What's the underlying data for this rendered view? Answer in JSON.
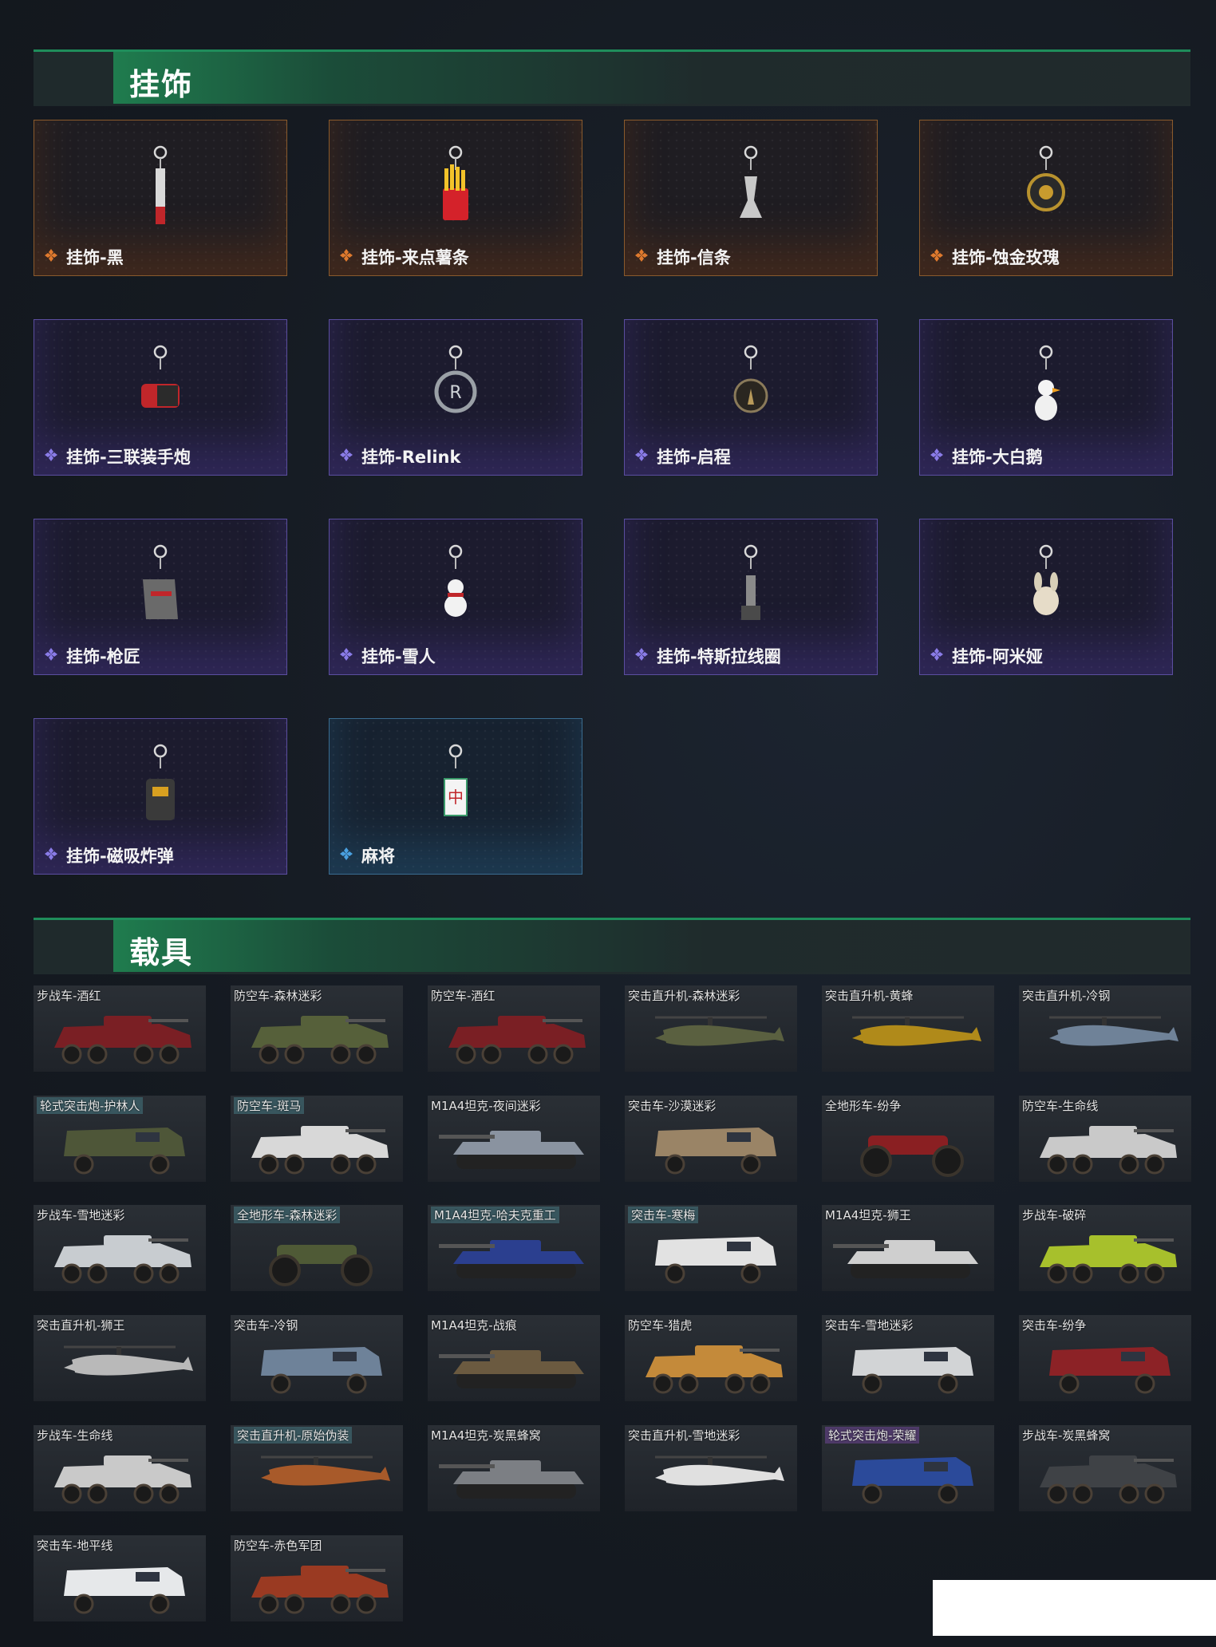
{
  "sections": {
    "pendants": {
      "title": "挂饰"
    },
    "vehicles": {
      "title": "载具"
    }
  },
  "pendants": [
    {
      "label": "挂饰-黑",
      "rarity": "gold",
      "icon": "pendant-black-icon"
    },
    {
      "label": "挂饰-来点薯条",
      "rarity": "gold",
      "icon": "pendant-fries-icon"
    },
    {
      "label": "挂饰-信条",
      "rarity": "gold",
      "icon": "pendant-creed-icon"
    },
    {
      "label": "挂饰-蚀金玫瑰",
      "rarity": "gold",
      "icon": "pendant-rose-icon"
    },
    {
      "label": "挂饰-三联装手炮",
      "rarity": "purple",
      "icon": "pendant-handcannon-icon"
    },
    {
      "label": "挂饰-Relink",
      "rarity": "purple",
      "icon": "pendant-relink-icon"
    },
    {
      "label": "挂饰-启程",
      "rarity": "purple",
      "icon": "pendant-journey-icon"
    },
    {
      "label": "挂饰-大白鹅",
      "rarity": "purple",
      "icon": "pendant-goose-icon"
    },
    {
      "label": "挂饰-枪匠",
      "rarity": "purple",
      "icon": "pendant-gunsmith-icon"
    },
    {
      "label": "挂饰-雪人",
      "rarity": "purple",
      "icon": "pendant-snowman-icon"
    },
    {
      "label": "挂饰-特斯拉线圈",
      "rarity": "purple",
      "icon": "pendant-tesla-icon"
    },
    {
      "label": "挂饰-阿米娅",
      "rarity": "purple",
      "icon": "pendant-amiya-icon"
    },
    {
      "label": "挂饰-磁吸炸弹",
      "rarity": "purple",
      "icon": "pendant-bomb-icon"
    },
    {
      "label": "麻将",
      "rarity": "blue",
      "icon": "pendant-mahjong-icon"
    }
  ],
  "vehicles": [
    {
      "name": "步战车-酒红",
      "type": "ifv",
      "color": "#7a1f24",
      "hl": ""
    },
    {
      "name": "防空车-森林迷彩",
      "type": "ifv",
      "color": "#56603a",
      "hl": ""
    },
    {
      "name": "防空车-酒红",
      "type": "ifv",
      "color": "#7a1f24",
      "hl": ""
    },
    {
      "name": "突击直升机-森林迷彩",
      "type": "heli",
      "color": "#5a6040",
      "hl": ""
    },
    {
      "name": "突击直升机-黄蜂",
      "type": "heli",
      "color": "#b08a1a",
      "hl": ""
    },
    {
      "name": "突击直升机-冷钢",
      "type": "heli",
      "color": "#6f8298",
      "hl": ""
    },
    {
      "name": "轮式突击炮-护林人",
      "type": "armored",
      "color": "#4e5638",
      "hl": "hl"
    },
    {
      "name": "防空车-斑马",
      "type": "ifv",
      "color": "#d8d8d8",
      "hl": "hl"
    },
    {
      "name": "M1A4坦克-夜间迷彩",
      "type": "tank",
      "color": "#8a93a0",
      "hl": ""
    },
    {
      "name": "突击车-沙漠迷彩",
      "type": "truck",
      "color": "#9a8466",
      "hl": ""
    },
    {
      "name": "全地形车-纷争",
      "type": "atv",
      "color": "#8a1f22",
      "hl": ""
    },
    {
      "name": "防空车-生命线",
      "type": "ifv",
      "color": "#c9c9c9",
      "hl": ""
    },
    {
      "name": "步战车-雪地迷彩",
      "type": "ifv",
      "color": "#c8ccd0",
      "hl": ""
    },
    {
      "name": "全地形车-森林迷彩",
      "type": "atv",
      "color": "#4f5a36",
      "hl": "hl"
    },
    {
      "name": "M1A4坦克-哈夫克重工",
      "type": "tank",
      "color": "#2b3f8f",
      "hl": "hl"
    },
    {
      "name": "突击车-寒梅",
      "type": "truck",
      "color": "#e2e2e2",
      "hl": "hl"
    },
    {
      "name": "M1A4坦克-狮王",
      "type": "tank",
      "color": "#cfcfcf",
      "hl": ""
    },
    {
      "name": "步战车-破碎",
      "type": "ifv",
      "color": "#a7c02c",
      "hl": ""
    },
    {
      "name": "突击直升机-狮王",
      "type": "heli",
      "color": "#b9b9b9",
      "hl": ""
    },
    {
      "name": "突击车-冷钢",
      "type": "truck",
      "color": "#6e8299",
      "hl": ""
    },
    {
      "name": "M1A4坦克-战痕",
      "type": "tank",
      "color": "#6b5a40",
      "hl": ""
    },
    {
      "name": "防空车-猎虎",
      "type": "ifv",
      "color": "#c48a3a",
      "hl": ""
    },
    {
      "name": "突击车-雪地迷彩",
      "type": "truck",
      "color": "#d2d4d6",
      "hl": ""
    },
    {
      "name": "突击车-纷争",
      "type": "truck",
      "color": "#8c2226",
      "hl": ""
    },
    {
      "name": "步战车-生命线",
      "type": "ifv",
      "color": "#c9c9c9",
      "hl": ""
    },
    {
      "name": "突击直升机-原始伪装",
      "type": "heli",
      "color": "#a85a2a",
      "hl": "hl"
    },
    {
      "name": "M1A4坦克-炭黑蜂窝",
      "type": "tank",
      "color": "#7c7f84",
      "hl": ""
    },
    {
      "name": "突击直升机-雪地迷彩",
      "type": "heli",
      "color": "#e0e0e0",
      "hl": ""
    },
    {
      "name": "轮式突击炮-荣耀",
      "type": "armored",
      "color": "#2b4a9a",
      "hl": "hlp"
    },
    {
      "name": "步战车-炭黑蜂窝",
      "type": "ifv",
      "color": "#3f4246",
      "hl": ""
    },
    {
      "name": "突击车-地平线",
      "type": "truck",
      "color": "#e6e8ea",
      "hl": ""
    },
    {
      "name": "防空车-赤色军团",
      "type": "ifv",
      "color": "#9a3a22",
      "hl": ""
    }
  ]
}
